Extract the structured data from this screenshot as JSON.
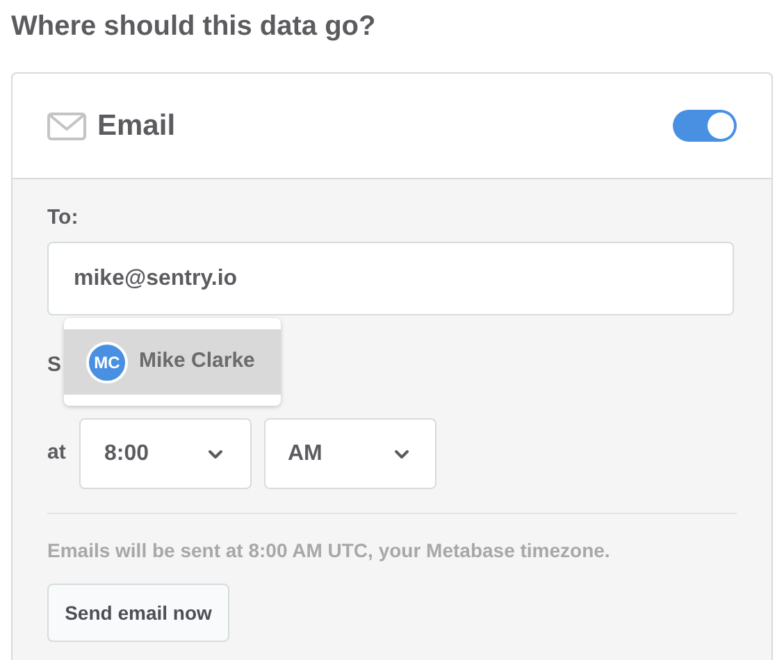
{
  "heading": "Where should this data go?",
  "channel": {
    "title": "Email",
    "on": true
  },
  "to": {
    "label": "To:",
    "value": "mike@sentry.io"
  },
  "suggestions": [
    {
      "initials": "MC",
      "name": "Mike Clarke",
      "selected": true
    }
  ],
  "schedule_label": "S",
  "time": {
    "label": "at",
    "hour": "8:00",
    "period": "AM"
  },
  "note": "Emails will be sent at 8:00 AM UTC, your Metabase timezone.",
  "button": "Send email now"
}
